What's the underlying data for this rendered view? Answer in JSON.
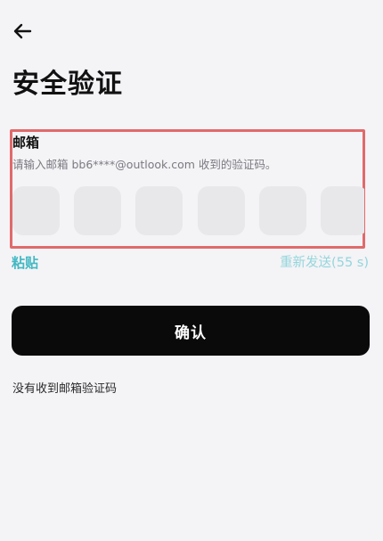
{
  "header": {
    "back_icon": "arrow-left-icon",
    "title": "安全验证"
  },
  "verification": {
    "field_label": "邮箱",
    "hint": "请输入邮箱 bb6****@outlook.com 收到的验证码。",
    "code_digits": [
      "",
      "",
      "",
      "",
      "",
      ""
    ],
    "highlight_color": "#e06a6a"
  },
  "actions": {
    "paste_label": "粘贴",
    "resend_label": "重新发送(55 s)",
    "confirm_label": "确认",
    "no_code_label": "没有收到邮箱验证码",
    "accent_color": "#41b8c3"
  }
}
